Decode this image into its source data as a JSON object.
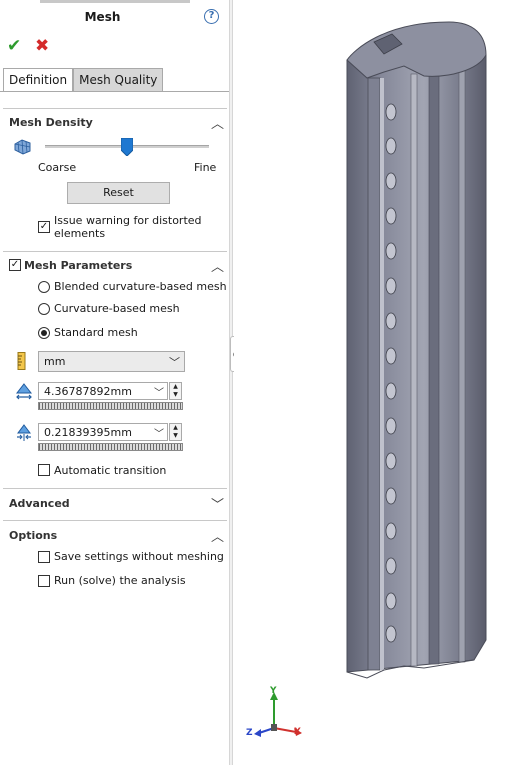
{
  "header": {
    "title": "Mesh",
    "help_label": "?"
  },
  "actions": {
    "ok_symbol": "✔",
    "cancel_symbol": "✖"
  },
  "tabs": [
    {
      "label": "Definition",
      "active": true
    },
    {
      "label": "Mesh Quality",
      "active": false
    }
  ],
  "mesh_density": {
    "title": "Mesh Density",
    "coarse_label": "Coarse",
    "fine_label": "Fine",
    "slider_value_fraction": 0.5,
    "reset_label": "Reset",
    "distortion_warning": {
      "label_line1": "Issue warning for distorted",
      "label_line2": "elements",
      "checked": true
    }
  },
  "mesh_parameters": {
    "title": "Mesh Parameters",
    "enabled": true,
    "options": [
      {
        "label": "Blended curvature-based mesh",
        "selected": false
      },
      {
        "label": "Curvature-based mesh",
        "selected": false
      },
      {
        "label": "Standard mesh",
        "selected": true
      }
    ],
    "unit": "mm",
    "element_size": "4.36787892mm",
    "tolerance": "0.21839395mm",
    "automatic_transition": {
      "label": "Automatic transition",
      "checked": false
    }
  },
  "advanced": {
    "title": "Advanced"
  },
  "options_section": {
    "title": "Options",
    "save_without_meshing": {
      "label": "Save settings without meshing",
      "checked": false
    },
    "run_analysis": {
      "label": "Run (solve) the analysis",
      "checked": false
    }
  },
  "viewport": {
    "triad": {
      "x": "X",
      "y": "Y",
      "z": "Z"
    },
    "colors": {
      "x_axis": "#d0312d",
      "y_axis": "#2e9b2e",
      "z_axis": "#2a46c8",
      "model": "#6e7182"
    }
  },
  "icons": {
    "help": "help-icon",
    "mesh_density": "mesh-density-icon",
    "unit": "ruler-icon",
    "element_size": "element-size-icon",
    "tolerance": "tolerance-icon"
  }
}
